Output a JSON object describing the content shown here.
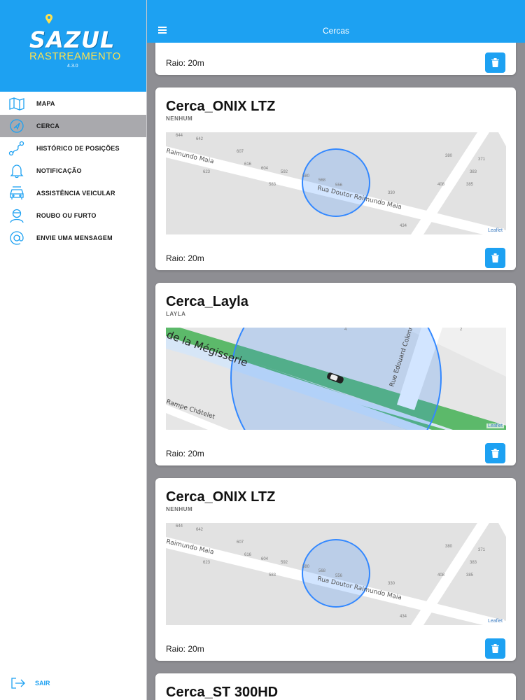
{
  "app": {
    "logo_main": "SAZUL",
    "logo_sub": "RASTREAMENTO",
    "version": "4.3.0",
    "brand_color": "#1da1f2",
    "accent_yellow": "#ffe14d"
  },
  "topbar": {
    "title": "Cercas",
    "menu_icon": "hamburger-icon"
  },
  "sidebar": {
    "items": [
      {
        "label": "MAPA",
        "icon": "map-icon",
        "active": false
      },
      {
        "label": "CERCA",
        "icon": "fence-icon",
        "active": true
      },
      {
        "label": "HISTÓRICO DE POSIÇÕES",
        "icon": "route-icon",
        "active": false
      },
      {
        "label": "NOTIFICAÇÃO",
        "icon": "bell-icon",
        "active": false
      },
      {
        "label": "ASSISTÊNCIA VEICULAR",
        "icon": "car-icon",
        "active": false
      },
      {
        "label": "ROUBO OU FURTO",
        "icon": "thief-icon",
        "active": false
      },
      {
        "label": "ENVIE UMA MENSAGEM",
        "icon": "at-icon",
        "active": false
      }
    ],
    "logout": {
      "label": "SAIR",
      "icon": "logout-icon"
    }
  },
  "cards": [
    {
      "raio": "Raio: 20m"
    },
    {
      "title": "Cerca_ONIX LTZ",
      "subtitle": "NENHUM",
      "map": {
        "street": "Rua Doutor Raimundo Maia",
        "street_left": "Raimundo Maia",
        "numbers": [
          "644",
          "642",
          "607",
          "623",
          "616",
          "604",
          "592",
          "583",
          "580",
          "568",
          "556",
          "330",
          "434",
          "380",
          "371",
          "383",
          "408",
          "385"
        ],
        "attribution": "Leaflet"
      },
      "raio": "Raio: 20m"
    },
    {
      "title": "Cerca_Layla",
      "subtitle": "LAYLA",
      "map": {
        "street": "de la Mégisserie",
        "street2": "Rue Edouard Colonne",
        "street3": "Rampe Châtelet",
        "numbers": [
          "4",
          "2"
        ],
        "attribution": "Leaflet"
      },
      "raio": "Raio: 20m"
    },
    {
      "title": "Cerca_ONIX LTZ",
      "subtitle": "NENHUM",
      "map": {
        "street": "Rua Doutor Raimundo Maia",
        "street_left": "Raimundo Maia",
        "numbers": [
          "644",
          "642",
          "607",
          "623",
          "616",
          "604",
          "592",
          "583",
          "580",
          "568",
          "556",
          "330",
          "434",
          "380",
          "371",
          "383",
          "408",
          "385"
        ],
        "attribution": "Leaflet"
      },
      "raio": "Raio: 20m"
    },
    {
      "title": "Cerca_ST 300HD"
    }
  ]
}
